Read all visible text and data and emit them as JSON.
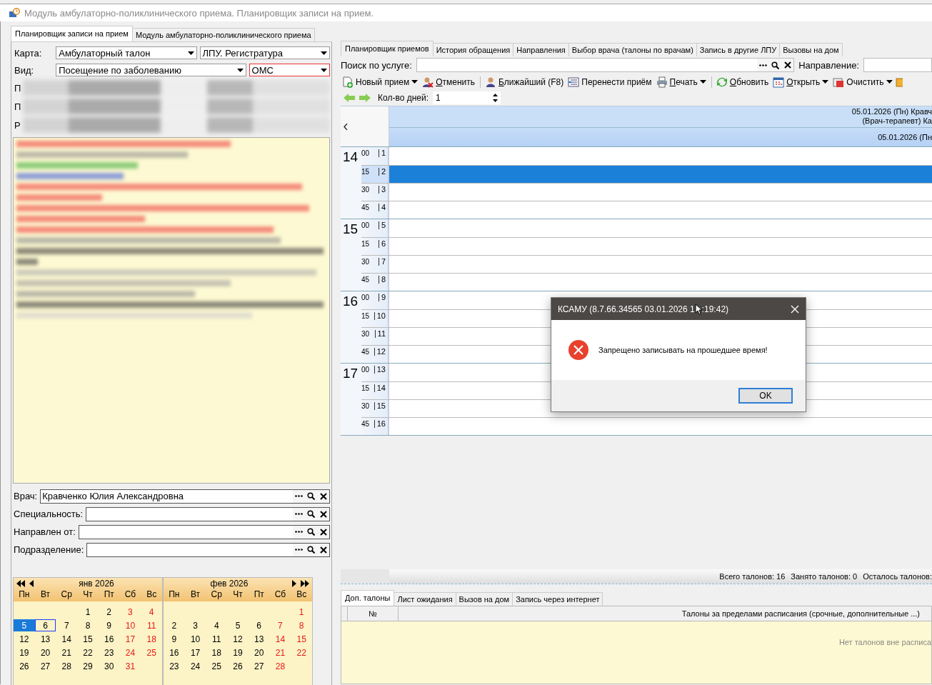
{
  "window": {
    "title": "Модуль амбулаторно-поликлинического приема. Планировщик записи на прием."
  },
  "left_tabs": [
    {
      "label": "Планировщик записи на прием",
      "selected": true
    },
    {
      "label": "Модуль амбулаторно-поликлинического приема",
      "selected": false
    }
  ],
  "form_rows": [
    {
      "label": "Карта:",
      "combos": [
        {
          "value": "Амбулаторный талон",
          "invalid": false
        },
        {
          "value": "ЛПУ. Регистратура",
          "invalid": false
        }
      ]
    },
    {
      "label": "Вид:",
      "combos": [
        {
          "value": "Посещение по заболеванию",
          "invalid": false
        },
        {
          "value": "ОМС",
          "invalid": true
        }
      ]
    }
  ],
  "hidden_rows": [
    {
      "label": "П"
    },
    {
      "label": "П"
    },
    {
      "label": "Р"
    }
  ],
  "lookups": [
    {
      "label": "Врач:",
      "value": "Кравченко Юлия Александровна"
    },
    {
      "label": "Специальность:"
    },
    {
      "label": "Направлен от:"
    },
    {
      "label": "Подразделение:"
    }
  ],
  "calendar": {
    "months": [
      {
        "title": "янв 2026",
        "weekdays": [
          "Пн",
          "Вт",
          "Ср",
          "Чт",
          "Пт",
          "Сб",
          "Вс"
        ],
        "weeks": [
          {
            "right_aligned": true,
            "days": [
              {
                "day": "1",
                "weekend": false,
                "selected": false,
                "today": false
              },
              {
                "day": "2",
                "weekend": false,
                "selected": false,
                "today": false
              },
              {
                "day": "3",
                "weekend": true,
                "selected": false,
                "today": false
              },
              {
                "day": "4",
                "weekend": true,
                "selected": false,
                "today": false
              }
            ]
          },
          {
            "right_aligned": false,
            "days": [
              {
                "day": "5",
                "weekend": false,
                "selected": true,
                "today": false
              },
              {
                "day": "6",
                "weekend": false,
                "selected": false,
                "today": true
              },
              {
                "day": "7",
                "weekend": false,
                "selected": false,
                "today": false
              },
              {
                "day": "8",
                "weekend": false,
                "selected": false,
                "today": false
              },
              {
                "day": "9",
                "weekend": false,
                "selected": false,
                "today": false
              },
              {
                "day": "10",
                "weekend": true,
                "selected": false,
                "today": false
              },
              {
                "day": "11",
                "weekend": true,
                "selected": false,
                "today": false
              }
            ]
          },
          {
            "right_aligned": false,
            "days": [
              {
                "day": "12",
                "weekend": false,
                "selected": false,
                "today": false
              },
              {
                "day": "13",
                "weekend": false,
                "selected": false,
                "today": false
              },
              {
                "day": "14",
                "weekend": false,
                "selected": false,
                "today": false
              },
              {
                "day": "15",
                "weekend": false,
                "selected": false,
                "today": false
              },
              {
                "day": "16",
                "weekend": false,
                "selected": false,
                "today": false
              },
              {
                "day": "17",
                "weekend": true,
                "selected": false,
                "today": false
              },
              {
                "day": "18",
                "weekend": true,
                "selected": false,
                "today": false
              }
            ]
          },
          {
            "right_aligned": false,
            "days": [
              {
                "day": "19",
                "weekend": false,
                "selected": false,
                "today": false
              },
              {
                "day": "20",
                "weekend": false,
                "selected": false,
                "today": false
              },
              {
                "day": "21",
                "weekend": false,
                "selected": false,
                "today": false
              },
              {
                "day": "22",
                "weekend": false,
                "selected": false,
                "today": false
              },
              {
                "day": "23",
                "weekend": false,
                "selected": false,
                "today": false
              },
              {
                "day": "24",
                "weekend": true,
                "selected": false,
                "today": false
              },
              {
                "day": "25",
                "weekend": true,
                "selected": false,
                "today": false
              }
            ]
          },
          {
            "right_aligned": false,
            "days": [
              {
                "day": "26",
                "weekend": false,
                "selected": false,
                "today": false
              },
              {
                "day": "27",
                "weekend": false,
                "selected": false,
                "today": false
              },
              {
                "day": "28",
                "weekend": false,
                "selected": false,
                "today": false
              },
              {
                "day": "29",
                "weekend": false,
                "selected": false,
                "today": false
              },
              {
                "day": "30",
                "weekend": false,
                "selected": false,
                "today": false
              },
              {
                "day": "31",
                "weekend": true,
                "selected": false,
                "today": false
              }
            ]
          }
        ]
      },
      {
        "title": "фев 2026",
        "weekdays": [
          "Пн",
          "Вт",
          "Ср",
          "Чт",
          "Пт",
          "Сб",
          "Вс"
        ],
        "weeks": [
          {
            "right_aligned": true,
            "days": [
              {
                "day": "1",
                "weekend": true,
                "selected": false,
                "today": false
              }
            ]
          },
          {
            "right_aligned": false,
            "days": [
              {
                "day": "2",
                "weekend": false,
                "selected": false,
                "today": false
              },
              {
                "day": "3",
                "weekend": false,
                "selected": false,
                "today": false
              },
              {
                "day": "4",
                "weekend": false,
                "selected": false,
                "today": false
              },
              {
                "day": "5",
                "weekend": false,
                "selected": false,
                "today": false
              },
              {
                "day": "6",
                "weekend": false,
                "selected": false,
                "today": false
              },
              {
                "day": "7",
                "weekend": true,
                "selected": false,
                "today": false
              },
              {
                "day": "8",
                "weekend": true,
                "selected": false,
                "today": false
              }
            ]
          },
          {
            "right_aligned": false,
            "days": [
              {
                "day": "9",
                "weekend": false,
                "selected": false,
                "today": false
              },
              {
                "day": "10",
                "weekend": false,
                "selected": false,
                "today": false
              },
              {
                "day": "11",
                "weekend": false,
                "selected": false,
                "today": false
              },
              {
                "day": "12",
                "weekend": false,
                "selected": false,
                "today": false
              },
              {
                "day": "13",
                "weekend": false,
                "selected": false,
                "today": false
              },
              {
                "day": "14",
                "weekend": true,
                "selected": false,
                "today": false
              },
              {
                "day": "15",
                "weekend": true,
                "selected": false,
                "today": false
              }
            ]
          },
          {
            "right_aligned": false,
            "days": [
              {
                "day": "16",
                "weekend": false,
                "selected": false,
                "today": false
              },
              {
                "day": "17",
                "weekend": false,
                "selected": false,
                "today": false
              },
              {
                "day": "18",
                "weekend": false,
                "selected": false,
                "today": false
              },
              {
                "day": "19",
                "weekend": false,
                "selected": false,
                "today": false
              },
              {
                "day": "20",
                "weekend": false,
                "selected": false,
                "today": false
              },
              {
                "day": "21",
                "weekend": true,
                "selected": false,
                "today": false
              },
              {
                "day": "22",
                "weekend": true,
                "selected": false,
                "today": false
              }
            ]
          },
          {
            "right_aligned": false,
            "days": [
              {
                "day": "23",
                "weekend": false,
                "selected": false,
                "today": false
              },
              {
                "day": "24",
                "weekend": false,
                "selected": false,
                "today": false
              },
              {
                "day": "25",
                "weekend": false,
                "selected": false,
                "today": false
              },
              {
                "day": "26",
                "weekend": false,
                "selected": false,
                "today": false
              },
              {
                "day": "27",
                "weekend": false,
                "selected": false,
                "today": false
              },
              {
                "day": "28",
                "weekend": true,
                "selected": false,
                "today": false
              }
            ]
          }
        ]
      }
    ]
  },
  "right_tabs": [
    {
      "label": "Планировщик приемов",
      "selected": true
    },
    {
      "label": "История обращения",
      "selected": false
    },
    {
      "label": "Направления",
      "selected": false
    },
    {
      "label": "Выбор врача (талоны по врачам)",
      "selected": false
    },
    {
      "label": "Запись в другие ЛПУ",
      "selected": false
    },
    {
      "label": "Вызовы на дом",
      "selected": false
    }
  ],
  "service_search": {
    "label": "Поиск по услуге:"
  },
  "direction": {
    "label": "Направление:"
  },
  "toolbar": [
    {
      "label": "Новый прием",
      "dropdown": true,
      "mnemonic": false,
      "separator_before": false
    },
    {
      "label": "Отменить",
      "dropdown": false,
      "mnemonic": true,
      "separator_before": false
    },
    {
      "label": "Ближайший (F8)",
      "dropdown": false,
      "mnemonic": true,
      "separator_before": true
    },
    {
      "label": "Перенести приём",
      "dropdown": false,
      "mnemonic": false,
      "separator_before": false
    },
    {
      "label": "Печать",
      "dropdown": true,
      "mnemonic": true,
      "separator_before": false
    },
    {
      "label": "Обновить",
      "dropdown": false,
      "mnemonic": true,
      "separator_before": true
    },
    {
      "label": "Открыть",
      "dropdown": true,
      "mnemonic": true,
      "separator_before": false
    },
    {
      "label": "Очистить",
      "dropdown": true,
      "mnemonic": false,
      "separator_before": false
    }
  ],
  "days_control": {
    "label": "Кол-во дней:",
    "value": "1"
  },
  "schedule": {
    "header_line1": "05.01.2026 (Пн) Кравч",
    "header_line2": "(Врач-терапевт) Ка",
    "subheader": "05.01.2026 (Пн",
    "hours": [
      {
        "hour": "14",
        "slots": [
          {
            "minute": "00",
            "number": "1",
            "selected": false
          },
          {
            "minute": "15",
            "number": "2",
            "selected": true
          },
          {
            "minute": "30",
            "number": "3",
            "selected": false
          },
          {
            "minute": "45",
            "number": "4",
            "selected": false
          }
        ]
      },
      {
        "hour": "15",
        "slots": [
          {
            "minute": "00",
            "number": "5",
            "selected": false
          },
          {
            "minute": "15",
            "number": "6",
            "selected": false
          },
          {
            "minute": "30",
            "number": "7",
            "selected": false
          },
          {
            "minute": "45",
            "number": "8",
            "selected": false
          }
        ]
      },
      {
        "hour": "16",
        "slots": [
          {
            "minute": "00",
            "number": "9",
            "selected": false
          },
          {
            "minute": "15",
            "number": "10",
            "selected": false
          },
          {
            "minute": "30",
            "number": "11",
            "selected": false
          },
          {
            "minute": "45",
            "number": "12",
            "selected": false
          }
        ]
      },
      {
        "hour": "17",
        "slots": [
          {
            "minute": "00",
            "number": "13",
            "selected": false
          },
          {
            "minute": "15",
            "number": "14",
            "selected": false
          },
          {
            "minute": "30",
            "number": "15",
            "selected": false
          },
          {
            "minute": "45",
            "number": "16",
            "selected": false
          }
        ]
      }
    ]
  },
  "status": [
    "Всего талонов: 16",
    "Занято талонов: 0",
    "Осталось талонов:"
  ],
  "bottom_tabs": [
    {
      "label": "Доп. талоны",
      "selected": true
    },
    {
      "label": "Лист ожидания",
      "selected": false
    },
    {
      "label": "Вызов на дом",
      "selected": false
    },
    {
      "label": "Запись через интернет",
      "selected": false
    }
  ],
  "extra_grid": {
    "columns": [
      "№",
      "Талоны за пределами расписания (срочные, дополнительные ...)"
    ],
    "empty_text": "Нет талонов вне расписа"
  },
  "dialog": {
    "title_before_cursor": "КСАМУ (8.7.66.34565 03.01.2026 1",
    "title_after_cursor": ":19:42)",
    "message": "Запрещено записывать на прошедшее время!",
    "buttons": [
      "OK"
    ]
  }
}
